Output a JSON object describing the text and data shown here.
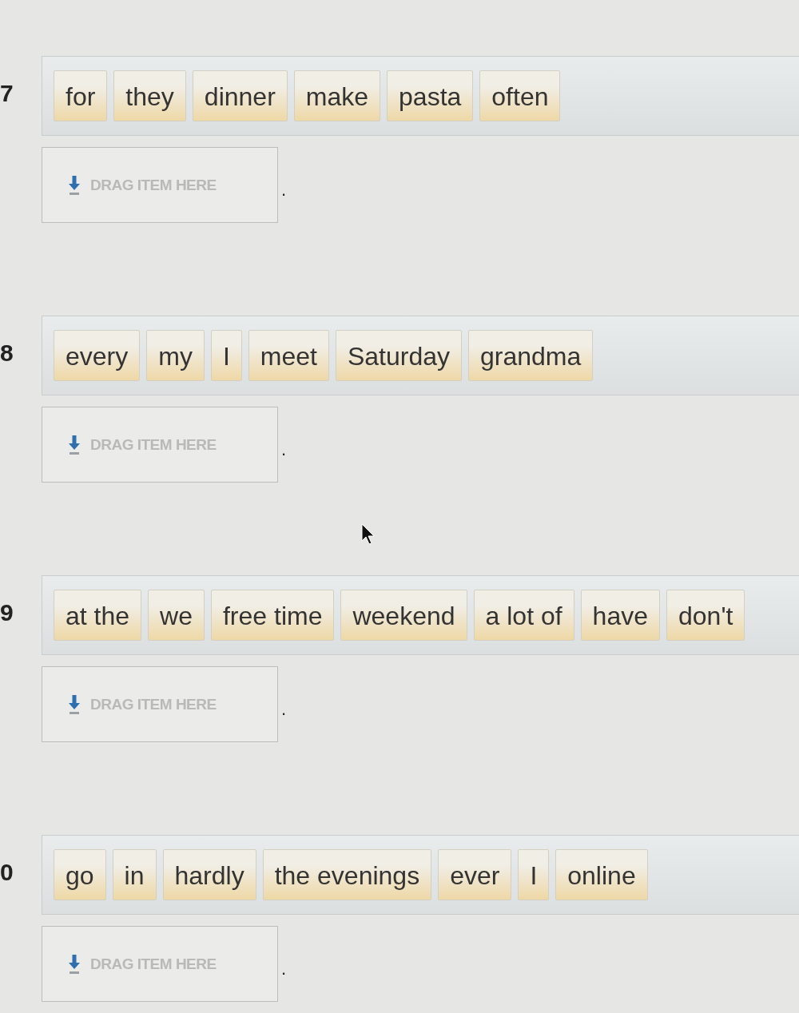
{
  "questions": [
    {
      "number": "7",
      "words": [
        "for",
        "they",
        "dinner",
        "make",
        "pasta",
        "often"
      ],
      "drop_zone": {
        "placeholder": "DRAG ITEM HERE"
      },
      "end_mark": "."
    },
    {
      "number": "8",
      "words": [
        "every",
        "my",
        "I",
        "meet",
        "Saturday",
        "grandma"
      ],
      "drop_zone": {
        "placeholder": "DRAG ITEM HERE"
      },
      "end_mark": "."
    },
    {
      "number": "9",
      "words": [
        "at the",
        "we",
        "free time",
        "weekend",
        "a lot of",
        "have",
        "don't"
      ],
      "drop_zone": {
        "placeholder": "DRAG ITEM HERE"
      },
      "end_mark": "."
    },
    {
      "number": "0",
      "words": [
        "go",
        "in",
        "hardly",
        "the evenings",
        "ever",
        "I",
        "online"
      ],
      "drop_zone": {
        "placeholder": "DRAG ITEM HERE"
      },
      "end_mark": "."
    }
  ]
}
